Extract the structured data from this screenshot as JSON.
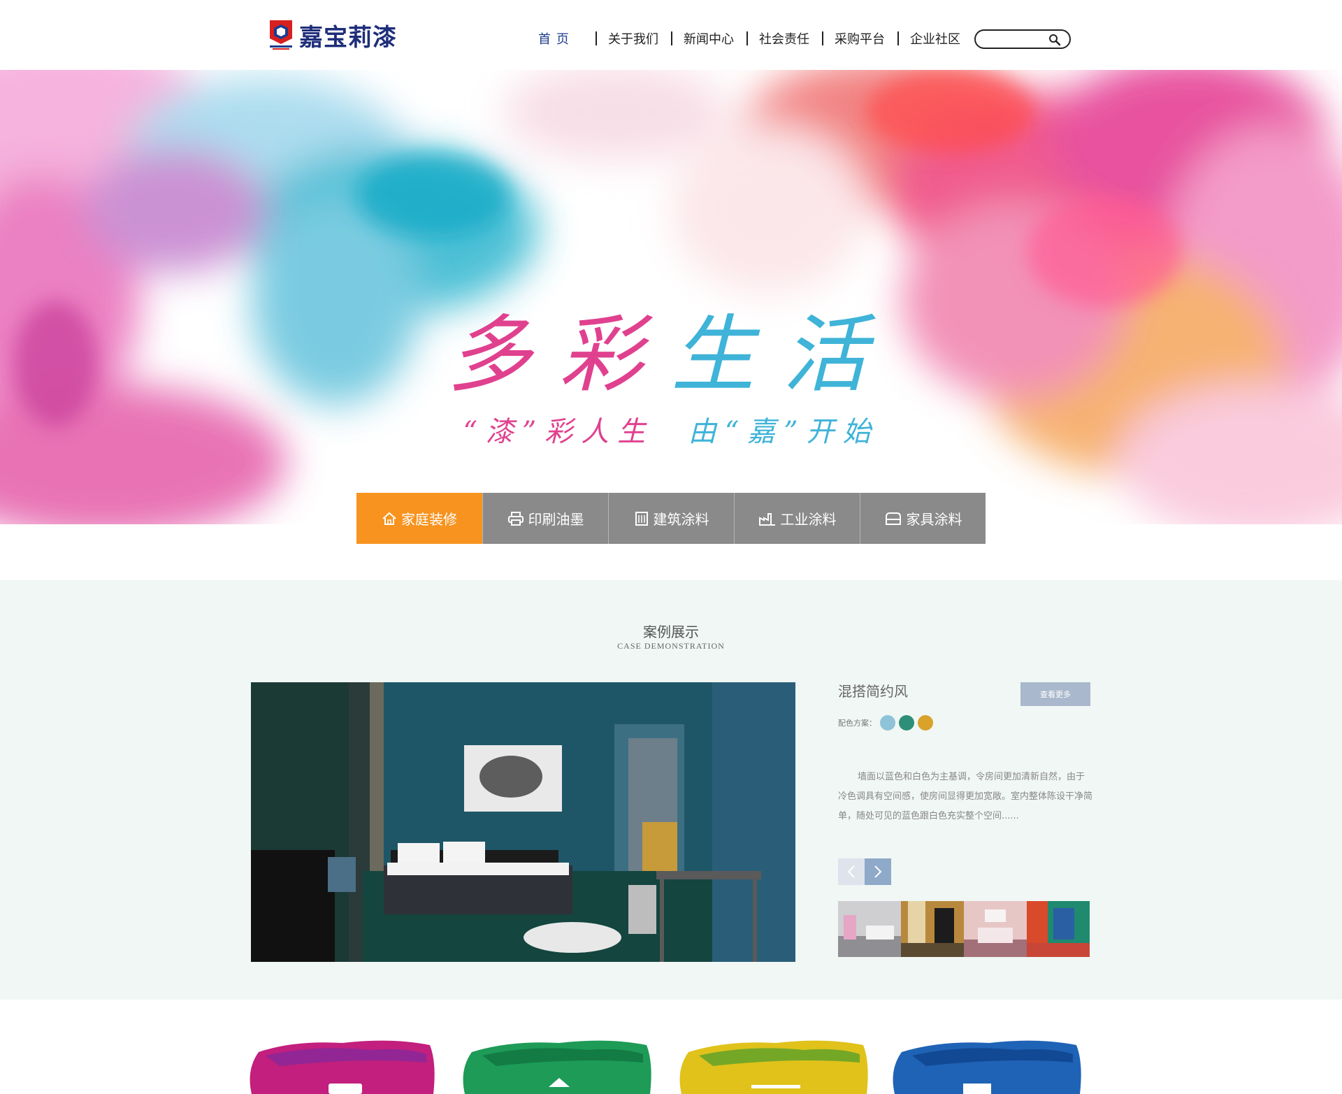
{
  "header": {
    "logo_text": "嘉宝莉漆",
    "nav": [
      {
        "label": "首页",
        "active": true
      },
      {
        "label": "关于我们"
      },
      {
        "label": "新闻中心"
      },
      {
        "label": "社会责任"
      },
      {
        "label": "采购平台"
      },
      {
        "label": "企业社区"
      }
    ],
    "search_placeholder": ""
  },
  "banner": {
    "title_part1": "多彩",
    "title_part2": "生活",
    "subtitle_part1": "“漆”彩人生",
    "subtitle_part2": "由“嘉”开始"
  },
  "tabs": [
    {
      "label": "家庭装修",
      "icon": "home-icon",
      "active": true
    },
    {
      "label": "印刷油墨",
      "icon": "printer-icon"
    },
    {
      "label": "建筑涂料",
      "icon": "building-icon"
    },
    {
      "label": "工业涂料",
      "icon": "factory-icon"
    },
    {
      "label": "家具涂料",
      "icon": "sofa-icon"
    }
  ],
  "case_section": {
    "title": "案例展示",
    "subtitle": "CASE DEMONSTRATION",
    "case_name": "混搭简约风",
    "more_label": "查看更多",
    "scheme_label": "配色方案：",
    "swatches": [
      "#8ec3d8",
      "#2e8f78",
      "#d9a22b"
    ],
    "description": "墙面以蓝色和白色为主基调，令房间更加清新自然，由于冷色调具有空间感，使房间显得更加宽敞。室内整体陈设干净简单，随处可见的蓝色跟白色充实整个空间......"
  },
  "colors": {
    "accent_orange": "#f7931e",
    "tab_gray": "#8a8a8a",
    "brand_blue": "#1e2e7a",
    "section_bg": "#f0f7f4"
  }
}
